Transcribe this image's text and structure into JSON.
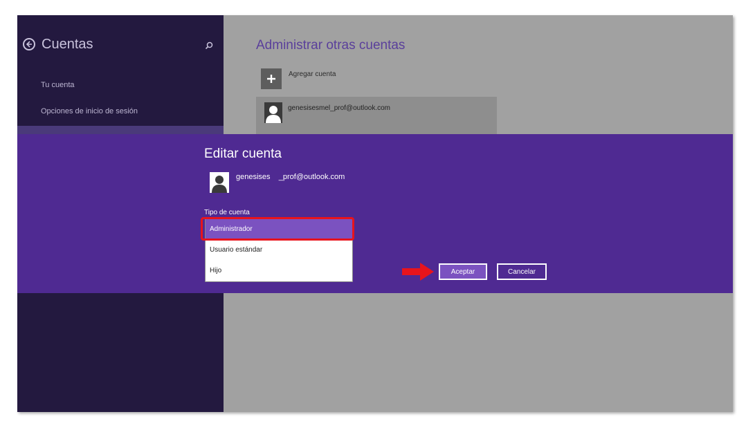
{
  "sidebar": {
    "title": "Cuentas",
    "items": [
      {
        "label": "Tu cuenta"
      },
      {
        "label": "Opciones de inicio de sesión"
      }
    ]
  },
  "main": {
    "heading": "Administrar otras cuentas",
    "add_account_label": "Agregar cuenta",
    "account_email": "genesisesmel_prof@outlook.com"
  },
  "dialog": {
    "title": "Editar cuenta",
    "email": "genesises    _prof@outlook.com",
    "type_label": "Tipo de cuenta",
    "options": [
      "Administrador",
      "Usuario estándar",
      "Hijo"
    ],
    "selected_option": "Administrador",
    "accept_label": "Aceptar",
    "cancel_label": "Cancelar"
  },
  "colors": {
    "sidebar_bg": "#23193f",
    "dialog_bg": "#4f2a92",
    "accent": "#7b52c0",
    "highlight": "#e8141c"
  },
  "icons": [
    "back-arrow-icon",
    "search-icon",
    "plus-icon",
    "user-icon",
    "red-arrow-icon"
  ]
}
